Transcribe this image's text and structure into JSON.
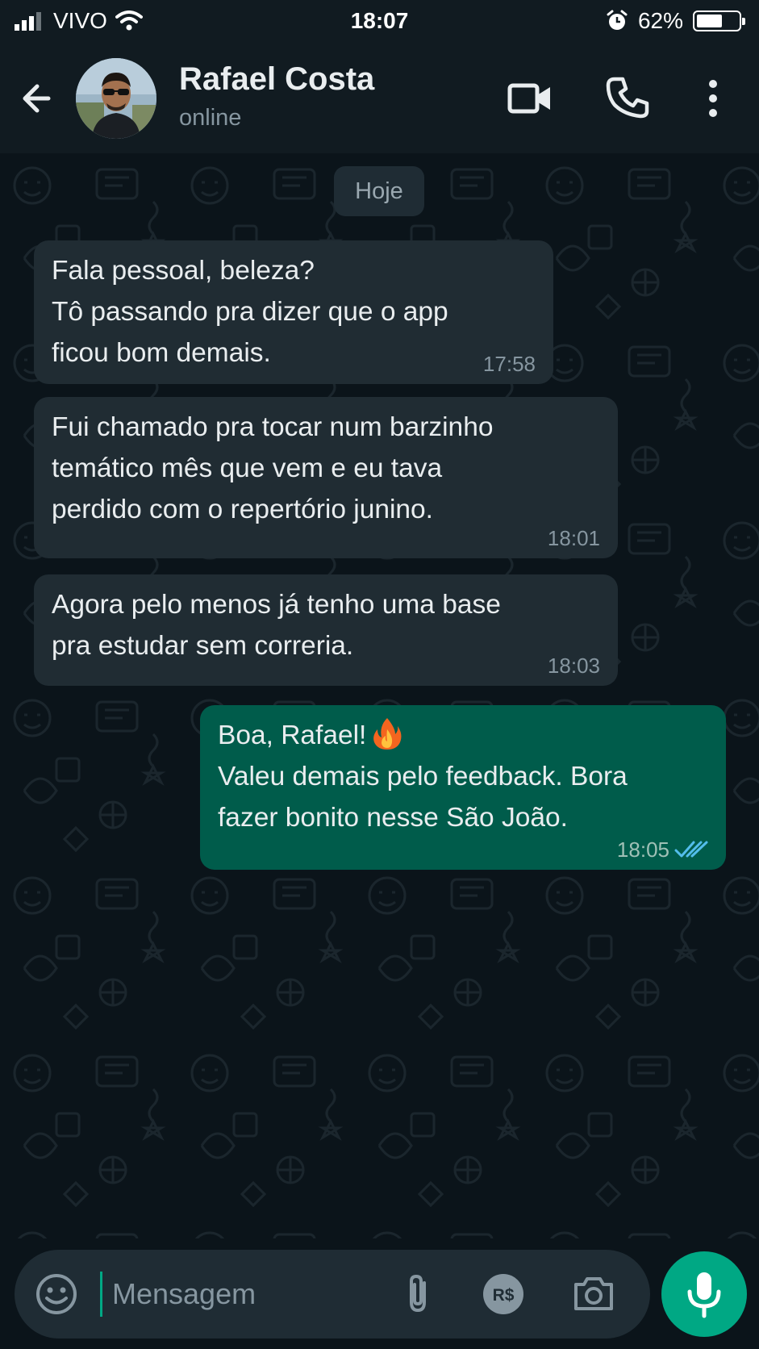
{
  "status_bar": {
    "carrier": "VIVO",
    "time": "18:07",
    "battery_percent_label": "62%",
    "battery_level": 0.62
  },
  "header": {
    "contact_name": "Rafael Costa",
    "contact_status": "online",
    "icons": [
      "back-arrow-icon",
      "video-call-icon",
      "phone-icon",
      "more-options-icon"
    ]
  },
  "chat": {
    "date_label": "Hoje",
    "messages": [
      {
        "direction": "in",
        "text": "Fala pessoal, beleza?\nTô passando pra dizer que o app\nficou bom demais.",
        "time": "17:58"
      },
      {
        "direction": "in",
        "text": "Fui chamado pra tocar num barzinho\ntemático mês que vem e eu tava\nperdido com o repertório junino.",
        "time": "18:01"
      },
      {
        "direction": "in",
        "text": "Agora pelo menos já tenho uma base\npra estudar sem correria.",
        "time": "18:03"
      },
      {
        "direction": "out",
        "line1": "Boa, Rafael!",
        "text": "Valeu demais pelo feedback. Bora\nfazer bonito nesse São João.",
        "time": "18:05",
        "status": "read"
      }
    ]
  },
  "composer": {
    "placeholder": "Mensagem",
    "value": "",
    "icons": [
      "emoji-icon",
      "attach-icon",
      "payment-icon",
      "camera-icon",
      "mic-icon"
    ]
  },
  "colors": {
    "accent": "#00a884",
    "outgoing_bubble": "#005c4b",
    "incoming_bubble": "#202c33",
    "header_bg": "#111b21",
    "chat_bg": "#0b141a",
    "read_ticks": "#53bdeb"
  }
}
